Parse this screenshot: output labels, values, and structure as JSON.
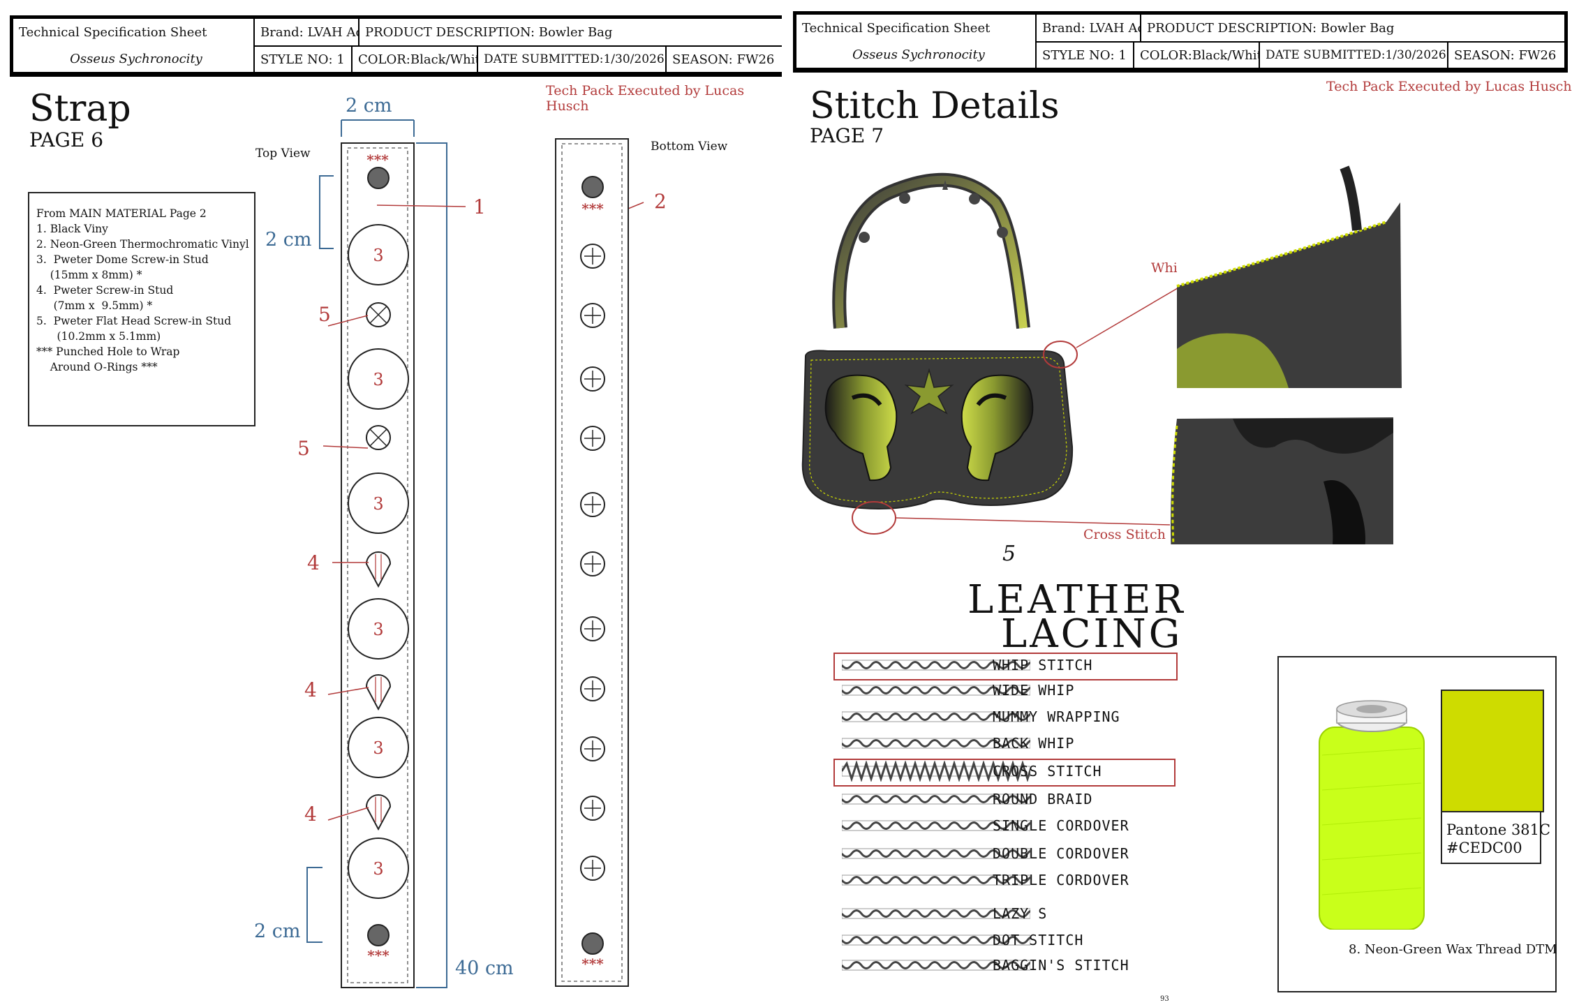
{
  "header": {
    "sheet_title": "Technical Specification Sheet",
    "collection": "Osseus Sychronocity",
    "brand": "Brand: LVAH Acce",
    "description": "PRODUCT DESCRIPTION:  Bowler Bag",
    "style": "STYLE NO: 1",
    "color": "COLOR:Black/White",
    "date": "DATE SUBMITTED:1/30/2026",
    "season": "SEASON: FW26"
  },
  "credit": "Tech Pack Executed by Lucas Husch",
  "strap_page": {
    "title": "Strap",
    "page": "PAGE 6",
    "top_view": "Top View",
    "bottom_view": "Bottom View",
    "materials": [
      "From MAIN MATERIAL Page 2",
      "1. Black Viny",
      "2. Neon-Green Thermochromatic Vinyl",
      "3.  Pweter Dome Screw-in Stud",
      "    (15mm x 8mm) *",
      "4.  Pweter Screw-in Stud",
      "     (7mm x  9.5mm) *",
      "5.  Pweter Flat Head Screw-in Stud",
      "      (10.2mm x 5.1mm)",
      "*** Punched Hole to Wrap",
      "    Around O-Rings ***"
    ],
    "dims": {
      "width": "2 cm",
      "top": "2 cm",
      "bottom": "2 cm",
      "length": "40 cm"
    },
    "punch": "***",
    "callouts": {
      "c1": "1",
      "c2": "2",
      "c3": "3",
      "c4": "4",
      "c5": "5"
    }
  },
  "stitch_page": {
    "title": "Stitch Details",
    "page": "PAGE 7",
    "whip_label": "Whip Stitch",
    "cross_label": "Cross Stitch",
    "lacing_number": "5",
    "lacing_title_1": "LEATHER",
    "lacing_title_2": "LACING",
    "lacing": [
      "WHIP STITCH",
      "WIDE WHIP",
      "MUMMY WRAPPING",
      "BACK WHIP",
      "CROSS STITCH",
      "ROUND BRAID",
      "SINGLE CORDOVER",
      "DOUBLE CORDOVER",
      "TRIPLE CORDOVER",
      "LAZY S",
      "DOT STITCH",
      "BAGGIN'S STITCH"
    ],
    "highlighted": [
      "WHIP STITCH",
      "CROSS STITCH"
    ],
    "pantone": "Pantone 381C\n#CEDC00",
    "thread": "8. Neon-Green Wax Thread DTM",
    "page_number": "93",
    "colors": {
      "accent_red": "#b23a3a",
      "dim_blue": "#3c6a94",
      "neon_green": "#cedc00",
      "bag_black": "#3a3a3a"
    }
  }
}
